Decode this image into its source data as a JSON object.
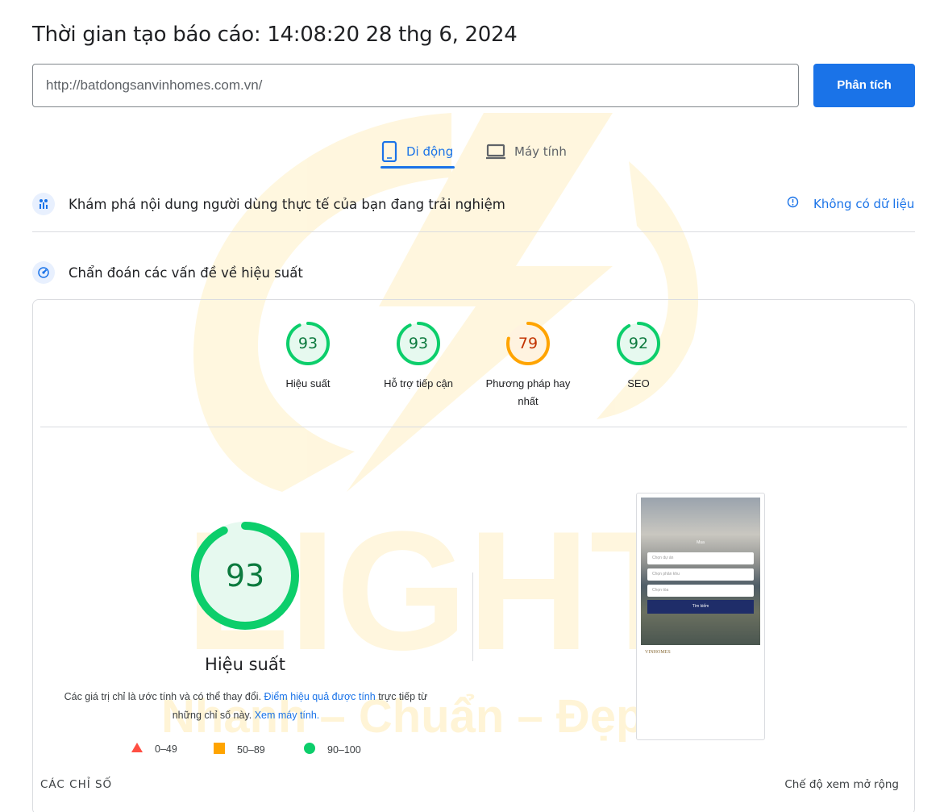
{
  "header": {
    "report_time": "Thời gian tạo báo cáo: 14:08:20 28 thg 6, 2024"
  },
  "url_input": {
    "value": "http://batdongsanvinhomes.com.vn/"
  },
  "analyze_button": {
    "label": "Phân tích"
  },
  "tabs": [
    {
      "label": "Di động",
      "icon": "smartphone-icon",
      "active": true
    },
    {
      "label": "Máy tính",
      "icon": "laptop-icon",
      "active": false
    }
  ],
  "field_data": {
    "title": "Khám phá nội dung người dùng thực tế của bạn đang trải nghiệm",
    "status": "Không có dữ liệu"
  },
  "diagnose": {
    "title": "Chẩn đoán các vấn đề về hiệu suất"
  },
  "scores": [
    {
      "label": "Hiệu suất",
      "value": 93,
      "color": "#0cce6b",
      "text_color": "#0c7a3e"
    },
    {
      "label": "Hỗ trợ tiếp cận",
      "value": 93,
      "color": "#0cce6b",
      "text_color": "#0c7a3e"
    },
    {
      "label": "Phương pháp hay nhất",
      "value": 79,
      "color": "#ffa400",
      "text_color": "#c33300"
    },
    {
      "label": "SEO",
      "value": 92,
      "color": "#0cce6b",
      "text_color": "#0c7a3e"
    }
  ],
  "performance": {
    "score": 93,
    "label": "Hiệu suất",
    "disclaimer_1": "Các giá trị chỉ là ước tính và có thể thay đổi.",
    "disclaimer_link_1": "Điểm hiệu quả được tính",
    "disclaimer_2": "trực tiếp từ những chỉ số này.",
    "disclaimer_link_2": "Xem máy tính."
  },
  "legend": [
    {
      "range": "0–49",
      "shape": "triangle",
      "color": "#ff4e42"
    },
    {
      "range": "50–89",
      "shape": "square",
      "color": "#ffa400"
    },
    {
      "range": "90–100",
      "shape": "circle",
      "color": "#0cce6b"
    }
  ],
  "screenshot": {
    "heading": "Mua",
    "field_1": "Chọn dự án",
    "field_2": "Chọn phân khu",
    "field_3": "Chọn tòa",
    "button": "Tìm kiếm",
    "logo": "VINHOMES"
  },
  "footer": {
    "metrics": "CÁC CHỈ SỐ",
    "expand": "Chế độ xem mở rộng"
  },
  "watermark": {
    "word": "LIGHT",
    "tagline": "Nhanh – Chuẩn – Đẹp",
    "color": "#ffc107"
  }
}
